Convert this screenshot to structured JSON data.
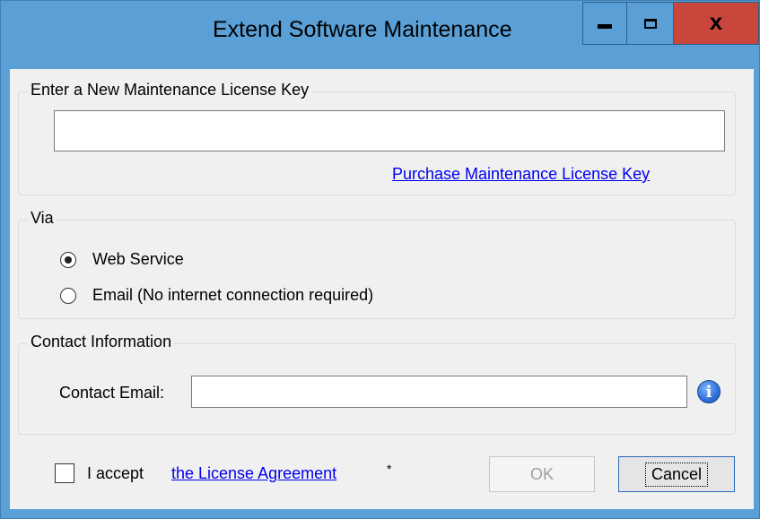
{
  "window": {
    "title": "Extend Software Maintenance",
    "controls": {
      "minimize": "minimize-icon",
      "maximize": "maximize-icon",
      "close": "close-icon",
      "close_glyph": "x"
    }
  },
  "license_group": {
    "legend": "Enter a New Maintenance License Key",
    "key_value": "",
    "purchase_link": "Purchase Maintenance License Key"
  },
  "via_group": {
    "legend": "Via",
    "options": [
      {
        "label": "Web Service",
        "checked": true
      },
      {
        "label": "Email (No internet connection required)",
        "checked": false
      }
    ]
  },
  "contact_group": {
    "legend": "Contact Information",
    "email_label": "Contact Email:",
    "email_value": "",
    "info_glyph": "i"
  },
  "footer": {
    "accept_text": "I accept",
    "license_link": "the License Agreement",
    "required_marker": "*",
    "accept_checked": false,
    "ok_label": "OK",
    "cancel_label": "Cancel"
  },
  "colors": {
    "titlebar": "#5aa0d6",
    "close_button": "#c9463d",
    "client_bg": "#f0f0f0",
    "link": "#0000ee",
    "accent_border": "#2a6ab8"
  }
}
